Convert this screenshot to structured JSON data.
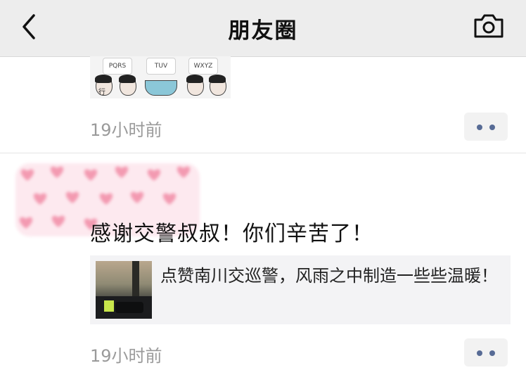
{
  "header": {
    "title": "朋友圈",
    "back_icon": "chevron-left-icon",
    "camera_icon": "camera-icon"
  },
  "post1": {
    "keyboard_keys": [
      "PQRS",
      "TUV",
      "WXYZ"
    ],
    "sticker_text": "行",
    "time": "19小时前"
  },
  "post2": {
    "text": "感谢交警叔叔！你们辛苦了！",
    "link": {
      "title": "点赞南川交巡警，风雨之中制造一些些温暖！"
    },
    "time": "19小时前"
  },
  "colors": {
    "accent": "#576b95",
    "header_bg": "#ededed",
    "time": "#9a9a9a",
    "card_bg": "#f3f3f5"
  }
}
